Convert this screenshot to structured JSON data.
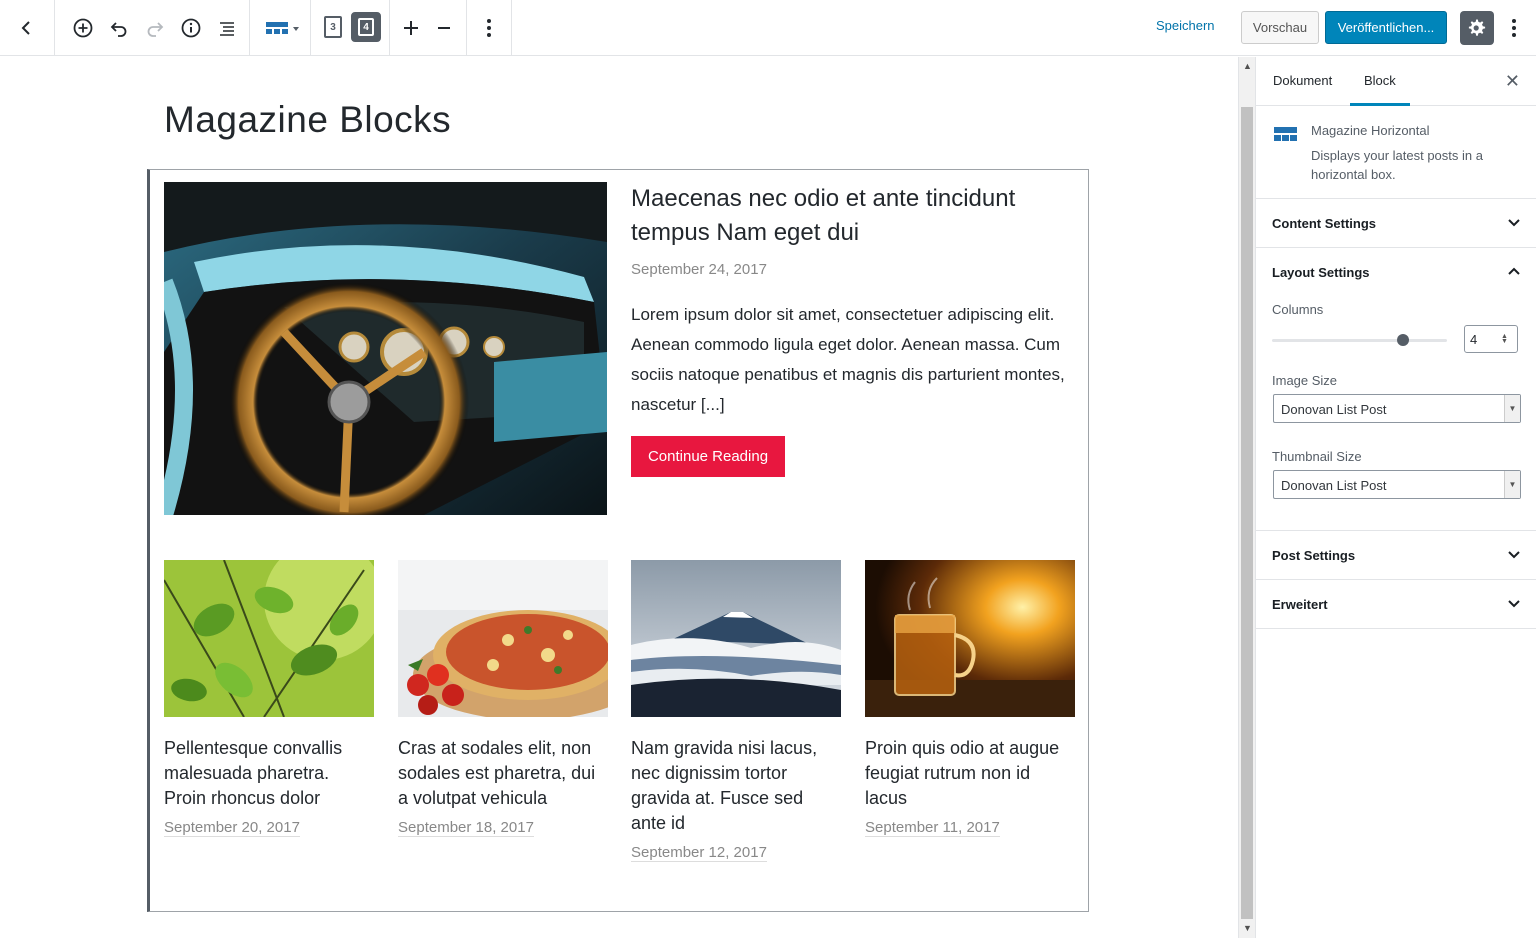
{
  "toolbar": {
    "col3_label": "3",
    "col4_label": "4",
    "save_label": "Speichern",
    "preview_label": "Vorschau",
    "publish_label": "Veröffentlichen..."
  },
  "editor": {
    "page_title": "Magazine Blocks",
    "hero": {
      "title": "Maecenas nec odio et ante tincidunt tempus Nam eget dui",
      "date": "September 24, 2017",
      "excerpt": "Lorem ipsum dolor sit amet, consectetuer adipiscing elit. Aenean commodo ligula eget dolor. Aenean massa. Cum sociis natoque penatibus et magnis dis parturient montes, nascetur [...]",
      "button": "Continue Reading"
    },
    "posts": [
      {
        "title": "Pellentesque convallis malesuada pharetra. Proin rhoncus dolor",
        "date": "September 20, 2017"
      },
      {
        "title": "Cras at sodales elit, non sodales est pharetra, dui a volutpat vehicula",
        "date": "September 18, 2017"
      },
      {
        "title": "Nam gravida nisi lacus, nec dignissim tortor gravida at. Fusce sed ante id",
        "date": "September 12, 2017"
      },
      {
        "title": "Proin quis odio at augue feugiat rutrum non id lacus",
        "date": "September 11, 2017"
      }
    ]
  },
  "sidebar": {
    "tab_document": "Dokument",
    "tab_block": "Block",
    "block_name": "Magazine Horizontal",
    "block_desc": "Displays your latest posts in a horizontal box.",
    "content_settings": "Content Settings",
    "layout_settings": "Layout Settings",
    "columns_label": "Columns",
    "columns_value": "4",
    "columns_level": 0.75,
    "image_size_label": "Image Size",
    "image_size_value": "Donovan List Post",
    "thumb_size_label": "Thumbnail Size",
    "thumb_size_value": "Donovan List Post",
    "post_settings": "Post Settings",
    "advanced": "Erweitert"
  },
  "colors": {
    "accent": "#0085ba",
    "link": "#0073aa",
    "button_red": "#e8173f"
  }
}
